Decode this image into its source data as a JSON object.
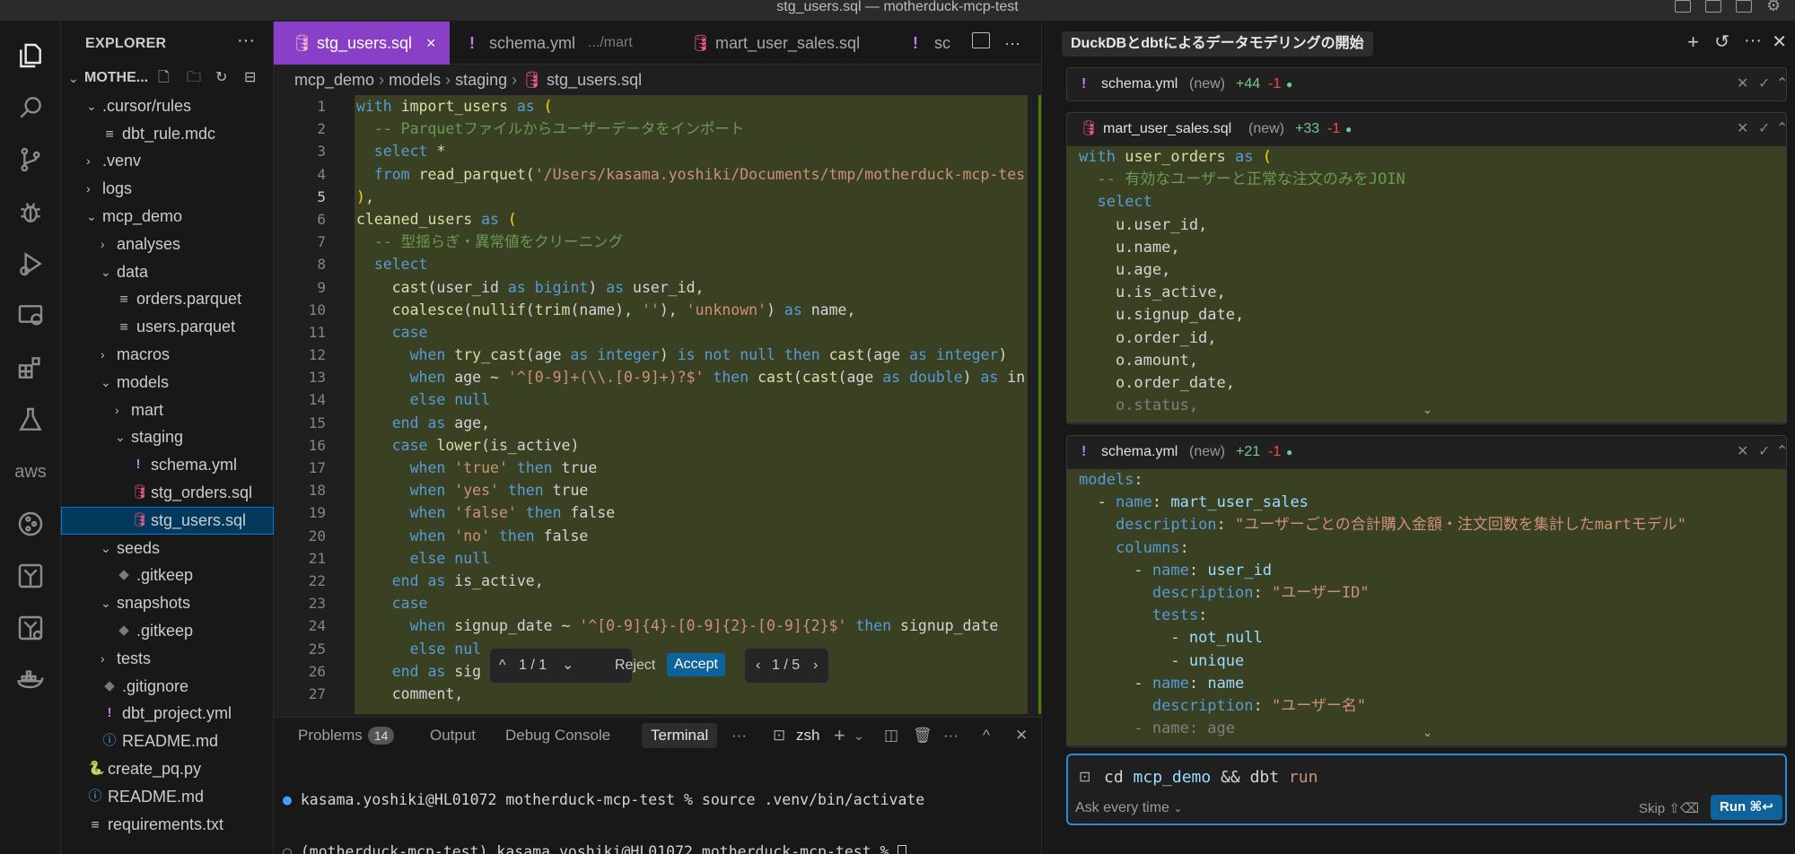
{
  "window": {
    "title": "stg_users.sql — motherduck-mcp-test"
  },
  "sidebar": {
    "header": "EXPLORER",
    "more": "···",
    "root": "MOTHE...",
    "rows": [
      {
        "label": ".cursor/rules",
        "indent": 1,
        "chev": "⌄",
        "kind": "folder"
      },
      {
        "label": "dbt_rule.mdc",
        "indent": 2,
        "chev": "",
        "kind": "lines"
      },
      {
        "label": ".venv",
        "indent": 1,
        "chev": "›",
        "kind": "folder"
      },
      {
        "label": "logs",
        "indent": 1,
        "chev": "›",
        "kind": "folder"
      },
      {
        "label": "mcp_demo",
        "indent": 1,
        "chev": "⌄",
        "kind": "folder"
      },
      {
        "label": "analyses",
        "indent": 2,
        "chev": "›",
        "kind": "folder"
      },
      {
        "label": "data",
        "indent": 2,
        "chev": "⌄",
        "kind": "folder"
      },
      {
        "label": "orders.parquet",
        "indent": 3,
        "chev": "",
        "kind": "lines"
      },
      {
        "label": "users.parquet",
        "indent": 3,
        "chev": "",
        "kind": "lines"
      },
      {
        "label": "macros",
        "indent": 2,
        "chev": "›",
        "kind": "folder"
      },
      {
        "label": "models",
        "indent": 2,
        "chev": "⌄",
        "kind": "folder"
      },
      {
        "label": "mart",
        "indent": 3,
        "chev": "›",
        "kind": "folder"
      },
      {
        "label": "staging",
        "indent": 3,
        "chev": "⌄",
        "kind": "folder"
      },
      {
        "label": "schema.yml",
        "indent": 4,
        "chev": "",
        "kind": "yml"
      },
      {
        "label": "stg_orders.sql",
        "indent": 4,
        "chev": "",
        "kind": "sql"
      },
      {
        "label": "stg_users.sql",
        "indent": 4,
        "chev": "",
        "kind": "sql",
        "selected": true
      },
      {
        "label": "seeds",
        "indent": 2,
        "chev": "⌄",
        "kind": "folder"
      },
      {
        "label": ".gitkeep",
        "indent": 3,
        "chev": "",
        "kind": "git"
      },
      {
        "label": "snapshots",
        "indent": 2,
        "chev": "⌄",
        "kind": "folder"
      },
      {
        "label": ".gitkeep",
        "indent": 3,
        "chev": "",
        "kind": "git"
      },
      {
        "label": "tests",
        "indent": 2,
        "chev": "›",
        "kind": "folder"
      },
      {
        "label": ".gitignore",
        "indent": 2,
        "chev": "",
        "kind": "git"
      },
      {
        "label": "dbt_project.yml",
        "indent": 2,
        "chev": "",
        "kind": "yml"
      },
      {
        "label": "README.md",
        "indent": 2,
        "chev": "",
        "kind": "md"
      },
      {
        "label": "create_pq.py",
        "indent": 1,
        "chev": "",
        "kind": "py"
      },
      {
        "label": "README.md",
        "indent": 1,
        "chev": "",
        "kind": "md"
      },
      {
        "label": "requirements.txt",
        "indent": 1,
        "chev": "",
        "kind": "lines"
      }
    ]
  },
  "tabs": [
    {
      "label": "stg_users.sql",
      "icon": "sql",
      "active": true,
      "close": "×"
    },
    {
      "label": "schema.yml",
      "icon": "yml",
      "suffix": ".../mart"
    },
    {
      "label": "mart_user_sales.sql",
      "icon": "sql"
    },
    {
      "label": "sc",
      "icon": "yml"
    }
  ],
  "breadcrumb": [
    "mcp_demo",
    "models",
    "staging",
    "stg_users.sql"
  ],
  "editor": {
    "current_line": 5,
    "lines": [
      "<span class=\"k\">with</span> <span class=\"f\">import_users</span> <span class=\"k\">as</span> <span class=\"p\">(</span>",
      "  <span class=\"c\">-- Parquetファイルからユーザーデータをインポート</span>",
      "  <span class=\"k\">select</span> *",
      "  <span class=\"k\">from</span> <span class=\"f\">read_parquet</span>(<span class=\"s\">'/Users/kasama.yoshiki/Documents/tmp/motherduck-mcp-tes</span>",
      "<span class=\"p\">)</span>,",
      "<span class=\"f\">cleaned_users</span> <span class=\"k\">as</span> <span class=\"p\">(</span>",
      "  <span class=\"c\">-- 型揺らぎ・異常値をクリーニング</span>",
      "  <span class=\"k\">select</span>",
      "    <span class=\"f\">cast</span>(user_id <span class=\"k\">as</span> <span class=\"k\">bigint</span>) <span class=\"k\">as</span> user_id,",
      "    <span class=\"f\">coalesce</span>(<span class=\"f\">nullif</span>(<span class=\"f\">trim</span>(name), <span class=\"s\">''</span>), <span class=\"s\">'unknown'</span>) <span class=\"k\">as</span> name,",
      "    <span class=\"k\">case</span>",
      "      <span class=\"k\">when</span> <span class=\"f\">try_cast</span>(age <span class=\"k\">as</span> <span class=\"k\">integer</span>) <span class=\"k\">is not null</span> <span class=\"k\">then</span> <span class=\"f\">cast</span>(age <span class=\"k\">as</span> <span class=\"k\">integer</span>)",
      "      <span class=\"k\">when</span> age ~ <span class=\"s\">'^[0-9]+(\\\\.[0-9]+)?$'</span> <span class=\"k\">then</span> <span class=\"f\">cast</span>(<span class=\"f\">cast</span>(age <span class=\"k\">as</span> <span class=\"k\">double</span>) <span class=\"k\">as</span> in",
      "      <span class=\"k\">else</span> <span class=\"k\">null</span>",
      "    <span class=\"k\">end</span> <span class=\"k\">as</span> age,",
      "    <span class=\"k\">case</span> <span class=\"f\">lower</span>(is_active)",
      "      <span class=\"k\">when</span> <span class=\"s\">'true'</span> <span class=\"k\">then</span> true",
      "      <span class=\"k\">when</span> <span class=\"s\">'yes'</span> <span class=\"k\">then</span> true",
      "      <span class=\"k\">when</span> <span class=\"s\">'false'</span> <span class=\"k\">then</span> false",
      "      <span class=\"k\">when</span> <span class=\"s\">'no'</span> <span class=\"k\">then</span> false",
      "      <span class=\"k\">else</span> <span class=\"k\">null</span>",
      "    <span class=\"k\">end</span> <span class=\"k\">as</span> is_active,",
      "    <span class=\"k\">case</span>",
      "      <span class=\"k\">when</span> signup_date ~ <span class=\"s\">'^[0-9]{4}-[0-9]{2}-[0-9]{2}$'</span> <span class=\"k\">then</span> signup_date",
      "      <span class=\"k\">else</span> <span class=\"k\">nul</span>",
      "    <span class=\"k\">end</span> <span class=\"k\">as</span> sig",
      "    comment,"
    ]
  },
  "inline_diff_bar": {
    "hunk": "1 / 1",
    "reject": "Reject",
    "accept": "Accept",
    "file_nav": "1 / 5"
  },
  "panel": {
    "tabs": [
      "Problems",
      "Output",
      "Debug Console",
      "Terminal"
    ],
    "problems_count": "14",
    "shell": "zsh",
    "terminal_lines": [
      "kasama.yoshiki@HL01072 motherduck-mcp-test % source .venv/bin/activate",
      "(motherduck-mcp-test) kasama.yoshiki@HL01072 motherduck-mcp-test % "
    ]
  },
  "agent": {
    "title": "DuckDBとdbtによるデータモデリングの開始",
    "cards": [
      {
        "file": "schema.yml",
        "tag": "(new)",
        "added": "+44",
        "removed": "-1",
        "icon": "yml",
        "lines": []
      },
      {
        "file": "mart_user_sales.sql",
        "tag": "(new)",
        "added": "+33",
        "removed": "-1",
        "icon": "sql",
        "lines": [
          "<span class=\"k\">with</span> <span class=\"f\">user_orders</span> <span class=\"k\">as</span> <span class=\"p\">(</span>",
          "  <span class=\"c\">-- 有効なユーザーと正常な注文のみをJOIN</span>",
          "  <span class=\"k\">select</span>",
          "    u.user_id,",
          "    u.name,",
          "    u.age,",
          "    u.is_active,",
          "    u.signup_date,",
          "    o.order_id,",
          "    o.amount,",
          "    o.order_date,",
          "    <span style=\"color:#808080\">o.status,</span>"
        ]
      },
      {
        "file": "schema.yml",
        "tag": "(new)",
        "added": "+21",
        "removed": "-1",
        "icon": "yml",
        "lines": [
          "<span class=\"yk\">models</span>:",
          "  - <span class=\"yk\">name</span>: <span class=\"yv\">mart_user_sales</span>",
          "    <span class=\"yk\">description</span>: <span class=\"ys\">\"ユーザーごとの合計購入金額・注文回数を集計したmartモデル\"</span>",
          "    <span class=\"yk\">columns</span>:",
          "      - <span class=\"yk\">name</span>: <span class=\"yv\">user_id</span>",
          "        <span class=\"yk\">description</span>: <span class=\"ys\">\"ユーザーID\"</span>",
          "        <span class=\"yk\">tests</span>:",
          "          - <span class=\"yv\">not_null</span>",
          "          - <span class=\"yv\">unique</span>",
          "      - <span class=\"yk\">name</span>: <span class=\"yv\">name</span>",
          "        <span class=\"yk\">description</span>: <span class=\"ys\">\"ユーザー名\"</span>",
          "      <span style=\"color:#808080\">- name: age</span>"
        ]
      }
    ],
    "composer": {
      "command": "cd <span style=\"color:#9cdcfe\">mcp_demo</span> && dbt <span style=\"color:#ce9178\">run</span>",
      "ask_mode": "Ask every time",
      "skip": "Skip ⇧⌫",
      "run": "Run ⌘↩"
    }
  },
  "colors": {
    "tab_active": "#8a3fc7",
    "accent": "#0e639c",
    "diff_bg": "#3a4022",
    "selection": "#04395e"
  }
}
